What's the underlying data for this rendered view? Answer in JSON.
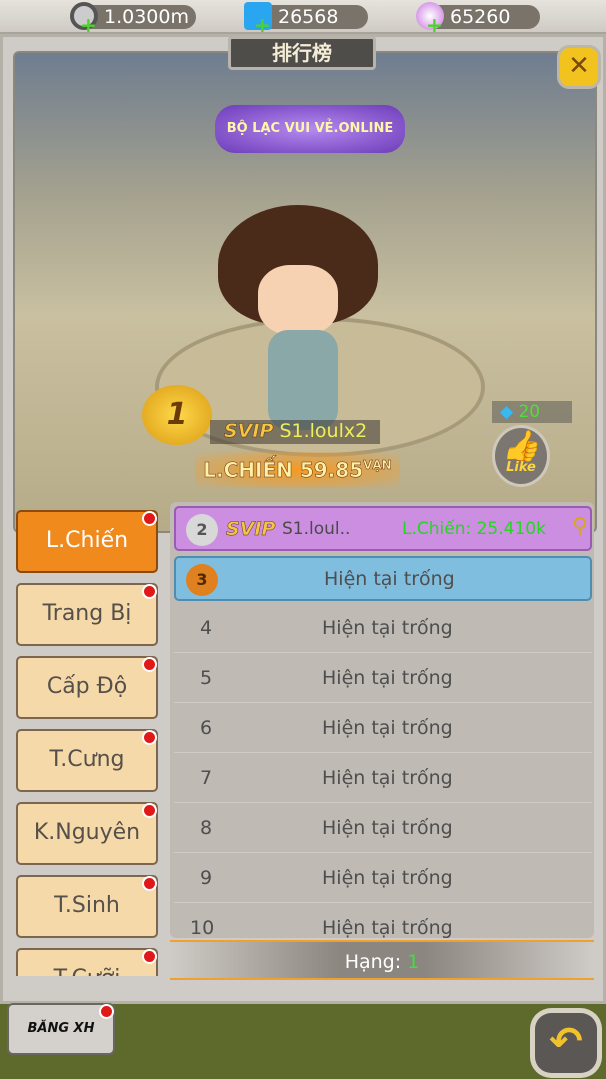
{
  "resources": [
    {
      "icon": "silver-coin-icon",
      "value": "1.0300m"
    },
    {
      "icon": "diamond-icon",
      "value": "26568"
    },
    {
      "icon": "shell-icon",
      "value": "65260"
    }
  ],
  "title": "排行榜",
  "server_logo": "BỘ LẠC VUI VẺ.ONLINE",
  "top_player": {
    "rank": "1",
    "vip": "SVIP",
    "name": "S1.loulx2",
    "power_label": "L.CHIẾN",
    "power": "59.85",
    "power_unit": "VẠN",
    "likes": "20",
    "like_label": "Like"
  },
  "tabs": [
    {
      "label": "L.Chiến",
      "active": true
    },
    {
      "label": "Trang Bị"
    },
    {
      "label": "Cấp Độ"
    },
    {
      "label": "T.Cưng"
    },
    {
      "label": "K.Nguyên"
    },
    {
      "label": "T.Sinh"
    },
    {
      "label": "T.Cưỡi"
    }
  ],
  "rank2": {
    "rank": "2",
    "vip": "SVIP",
    "name": "S1.loul..",
    "power": "L.Chiến:  25.410k"
  },
  "rows": [
    {
      "rank": "3",
      "text": "Hiện tại trống"
    },
    {
      "rank": "4",
      "text": "Hiện tại trống"
    },
    {
      "rank": "5",
      "text": "Hiện tại trống"
    },
    {
      "rank": "6",
      "text": "Hiện tại trống"
    },
    {
      "rank": "7",
      "text": "Hiện tại trống"
    },
    {
      "rank": "8",
      "text": "Hiện tại trống"
    },
    {
      "rank": "9",
      "text": "Hiện tại trống"
    },
    {
      "rank": "10",
      "text": "Hiện tại trống"
    }
  ],
  "footer": {
    "label": "Hạng:",
    "value": "1"
  },
  "bottom_button": "BĂNG XH",
  "colors": {
    "accent": "#f08a1c",
    "green": "#2fe02a",
    "purple": "#cc8ee0",
    "blue": "#80bedf"
  }
}
